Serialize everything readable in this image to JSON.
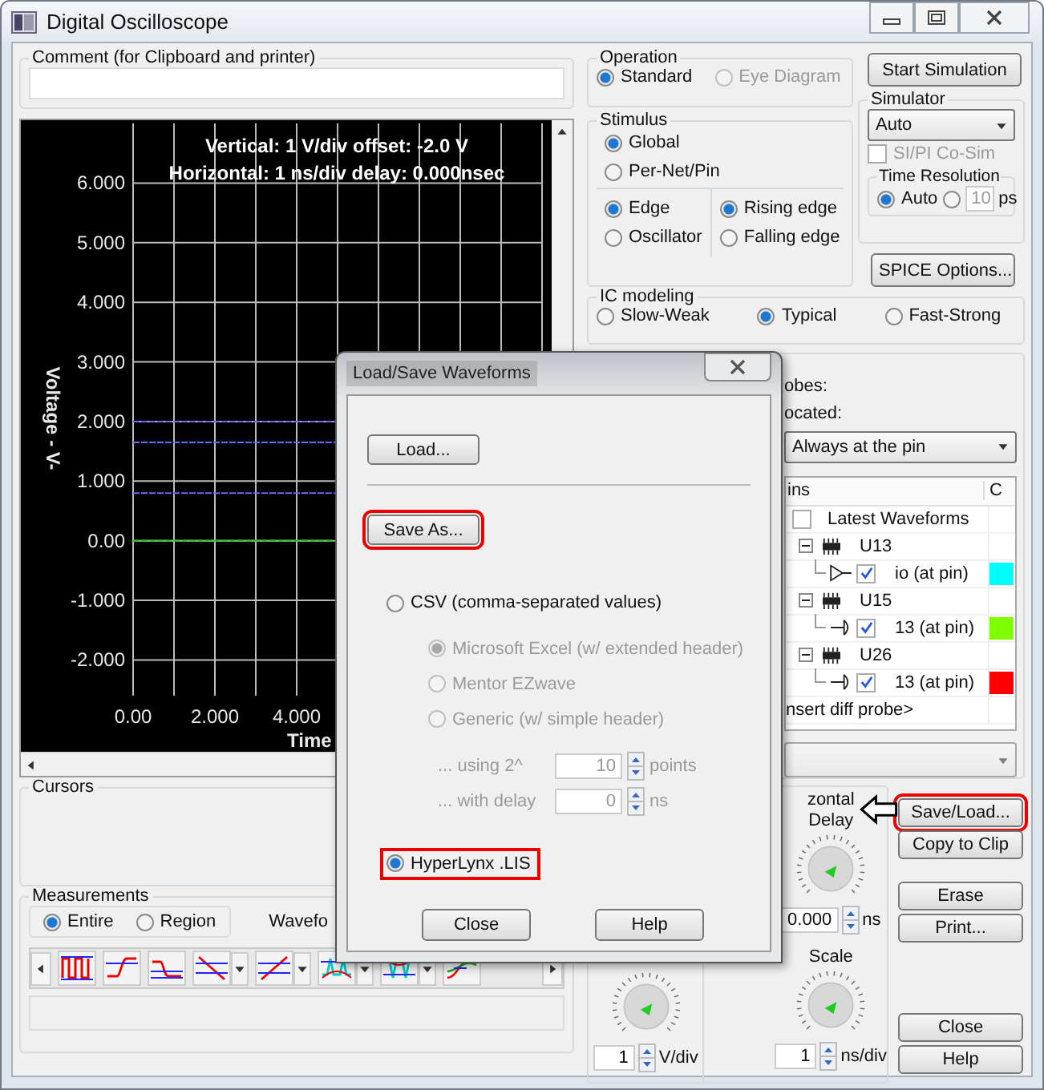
{
  "window": {
    "title": "Digital Oscilloscope"
  },
  "comment": {
    "label": "Comment (for Clipboard and printer)"
  },
  "scope": {
    "readout": [
      "Vertical: 1  V/div  offset: -2.0 V",
      "Horizontal: 1 ns/div  delay: 0.000nsec"
    ],
    "chart_data": {
      "type": "line",
      "xlabel": "Time",
      "ylabel": "Voltage - V-",
      "xlim": [
        0,
        10
      ],
      "ylim": [
        -2.6,
        7
      ],
      "grid": true,
      "xticks": [
        {
          "value": 0,
          "label": "0.00"
        },
        {
          "value": 2,
          "label": "2.000"
        },
        {
          "value": 4,
          "label": "4.000"
        }
      ],
      "yticks": [
        {
          "value": 6,
          "label": "6.000"
        },
        {
          "value": 5,
          "label": "5.000"
        },
        {
          "value": 4,
          "label": "4.000"
        },
        {
          "value": 3,
          "label": "3.000"
        },
        {
          "value": 2,
          "label": "2.000"
        },
        {
          "value": 1,
          "label": "1.000"
        },
        {
          "value": 0,
          "label": "0.00"
        },
        {
          "value": -1,
          "label": "-1.000"
        },
        {
          "value": -2,
          "label": "-2.000"
        }
      ],
      "x": [
        0,
        4.9
      ],
      "series": [
        {
          "color": "#22cc22",
          "line_style": "dashed",
          "values": [
            0,
            0
          ]
        }
      ],
      "ref_lines": [
        {
          "axis": "y",
          "value": 2.0,
          "color": "#6a6aff",
          "line_style": "dashed"
        },
        {
          "axis": "y",
          "value": 1.65,
          "color": "#6a6aff",
          "line_style": "dashed"
        },
        {
          "axis": "y",
          "value": 0.8,
          "color": "#6a6aff",
          "line_style": "dashed"
        }
      ]
    }
  },
  "cursors": {
    "label": "Cursors"
  },
  "measurements": {
    "label": "Measurements",
    "options": [
      {
        "label": "Entire",
        "selected": true
      },
      {
        "label": "Region",
        "selected": false
      }
    ],
    "waveform_label": "Wavefo",
    "tools": [
      {
        "kind": "pulse",
        "menu": false
      },
      {
        "kind": "rise",
        "menu": false
      },
      {
        "kind": "dip",
        "menu": false
      },
      {
        "kind": "slope-down",
        "menu": true
      },
      {
        "kind": "slope-up",
        "menu": true
      },
      {
        "kind": "overshoot",
        "menu": true
      },
      {
        "kind": "undershoot",
        "menu": true
      },
      {
        "kind": "crossing",
        "menu": false
      }
    ]
  },
  "operation": {
    "label": "Operation",
    "options": [
      {
        "label": "Standard",
        "selected": true,
        "disabled": false
      },
      {
        "label": "Eye Diagram",
        "selected": false,
        "disabled": true
      }
    ]
  },
  "stimulus": {
    "label": "Stimulus",
    "scope": [
      {
        "label": "Global",
        "selected": true
      },
      {
        "label": "Per-Net/Pin",
        "selected": false
      }
    ],
    "type": [
      {
        "label": "Edge",
        "selected": true
      },
      {
        "label": "Oscillator",
        "selected": false
      }
    ],
    "edge": [
      {
        "label": "Rising edge",
        "selected": true
      },
      {
        "label": "Falling edge",
        "selected": false
      }
    ]
  },
  "start_button": "Start Simulation",
  "simulator": {
    "label": "Simulator",
    "engine": "Auto",
    "cosim": {
      "label": "SI/PI Co-Sim",
      "checked": false,
      "disabled": true
    },
    "time_resolution": {
      "label": "Time Resolution",
      "auto": {
        "label": "Auto",
        "selected": true
      },
      "custom": {
        "selected": false,
        "disabled": true,
        "value": "10",
        "unit": "ps"
      }
    }
  },
  "spice_button": "SPICE Options...",
  "ic_modeling": {
    "label": "IC modeling",
    "options": [
      {
        "label": "Slow-Weak",
        "selected": false
      },
      {
        "label": "Typical",
        "selected": true
      },
      {
        "label": "Fast-Strong",
        "selected": false
      }
    ]
  },
  "probes": {
    "label": "obes:",
    "located_label": "ocated:",
    "located": "Always at the pin",
    "columns": [
      "ins",
      "C"
    ],
    "latest": {
      "label": "Latest Waveforms",
      "checked": false
    },
    "components": [
      {
        "name": "U13",
        "expanded": true,
        "children": [
          {
            "name": "io (at pin)",
            "kind": "output",
            "checked": true,
            "color": "#00ffff"
          }
        ]
      },
      {
        "name": "U15",
        "expanded": true,
        "children": [
          {
            "name": "13 (at pin)",
            "kind": "input",
            "checked": true,
            "color": "#80ff00"
          }
        ]
      },
      {
        "name": "U26",
        "expanded": true,
        "children": [
          {
            "name": "13 (at pin)",
            "kind": "input",
            "checked": true,
            "color": "#ff0000"
          }
        ]
      }
    ],
    "insert": "nsert diff probe>"
  },
  "horizontal": {
    "label": "zontal",
    "delay": {
      "label": "Delay",
      "value": "0.000",
      "unit": "ns"
    },
    "scale": {
      "label": "Scale",
      "value": "1",
      "unit": "ns/div"
    }
  },
  "vertical": {
    "value": "1",
    "unit": "V/div"
  },
  "side_buttons": [
    [
      {
        "label": "Save/Load...",
        "highlighted": true
      },
      {
        "label": "Copy to Clip",
        "highlighted": false
      }
    ],
    [
      {
        "label": "Erase",
        "highlighted": false
      },
      {
        "label": "Print...",
        "highlighted": false
      }
    ],
    [
      {
        "label": "Close",
        "highlighted": false
      },
      {
        "label": "Help",
        "highlighted": false
      }
    ]
  ],
  "dialog": {
    "title": "Load/Save Waveforms",
    "load": {
      "label": "Load...",
      "highlighted": false
    },
    "save_as": {
      "label": "Save As...",
      "highlighted": true
    },
    "csv": {
      "label": "CSV (comma-separated values)",
      "selected": false,
      "variants": [
        {
          "label": "Microsoft Excel (w/ extended header)",
          "selected": true,
          "disabled": true
        },
        {
          "label": "Mentor EZwave",
          "selected": false,
          "disabled": true
        },
        {
          "label": "Generic (w/ simple header)",
          "selected": false,
          "disabled": true
        }
      ],
      "points": {
        "label": "... using 2^",
        "value": "10",
        "unit": "points",
        "disabled": true
      },
      "delay": {
        "label": "... with delay",
        "value": "0",
        "unit": "ns",
        "disabled": true
      }
    },
    "lis": {
      "label": "HyperLynx .LIS",
      "selected": true,
      "highlighted": true
    },
    "buttons": [
      "Close",
      "Help"
    ]
  }
}
